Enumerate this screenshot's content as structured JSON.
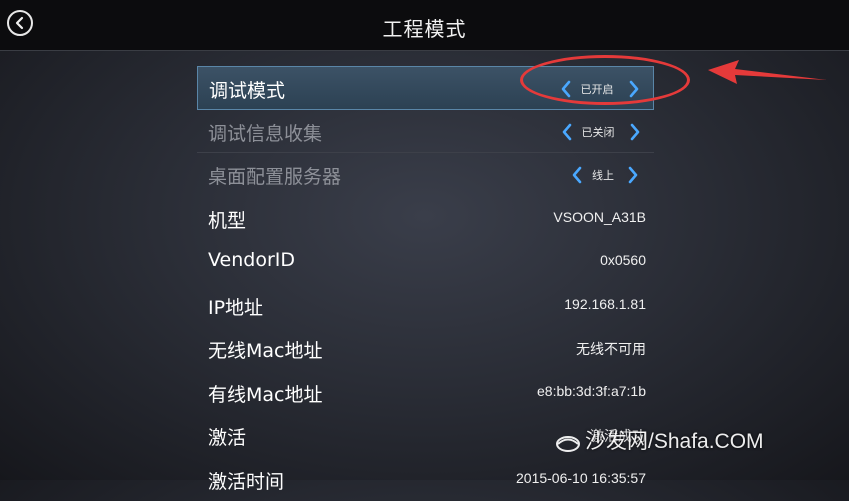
{
  "header": {
    "title": "工程模式"
  },
  "settings": {
    "rows": [
      {
        "label": "调试模式",
        "value": "已开启"
      },
      {
        "label": "调试信息收集",
        "value": "已关闭"
      },
      {
        "label": "桌面配置服务器",
        "value": "线上"
      },
      {
        "label": "机型",
        "value": "VSOON_A31B"
      },
      {
        "label": "VendorID",
        "value": "0x0560"
      },
      {
        "label": "IP地址",
        "value": "192.168.1.81"
      },
      {
        "label": "无线Mac地址",
        "value": "无线不可用"
      },
      {
        "label": "有线Mac地址",
        "value": "e8:bb:3d:3f:a7:1b"
      },
      {
        "label": "激活",
        "value": "激活成功"
      },
      {
        "label": "激活时间",
        "value": "2015-06-10 16:35:57"
      }
    ]
  },
  "watermark": {
    "text": "沙发网/Shafa.COM"
  },
  "colors": {
    "accent": "#4aa8ff",
    "selected_bg": "#34495c",
    "annotation": "#e53a3a"
  }
}
